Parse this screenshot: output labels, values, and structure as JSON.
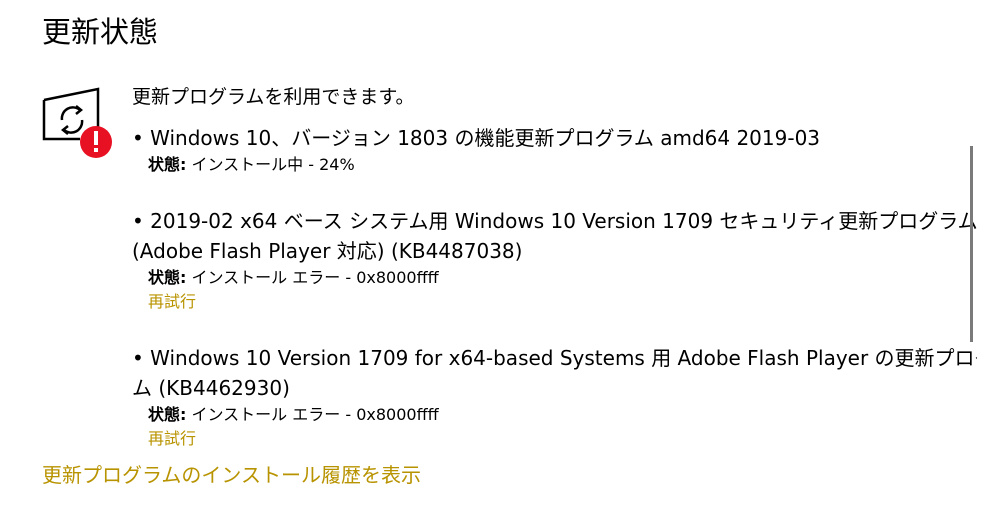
{
  "page": {
    "title": "更新状態"
  },
  "status": {
    "available_text": "更新プログラムを利用できます。",
    "icon": "sync-warning-icon",
    "warning_color": "#e81123"
  },
  "updates": [
    {
      "title_line1": "• Windows 10、バージョン 1803 の機能更新プログラム amd64 2019-03",
      "title_line2": "",
      "status_label": "状態:",
      "status_value": " インストール中 - 24%",
      "retry_label": ""
    },
    {
      "title_line1": "• 2019-02 x64 ベース システム用 Windows 10 Version 1709 セキュリティ更新プログラム",
      "title_line2": "(Adobe Flash Player 対応) (KB4487038)",
      "status_label": "状態:",
      "status_value": " インストール エラー - 0x8000ffff",
      "retry_label": "再試行"
    },
    {
      "title_line1": "• Windows 10 Version 1709 for x64-based Systems 用 Adobe Flash Player の更新プログラ",
      "title_line2": "ム (KB4462930)",
      "status_label": "状態:",
      "status_value": " インストール エラー - 0x8000ffff",
      "retry_label": "再試行"
    }
  ],
  "history_link": "更新プログラムのインストール履歴を表示",
  "colors": {
    "link": "#b89300",
    "text": "#000000",
    "background": "#ffffff"
  }
}
